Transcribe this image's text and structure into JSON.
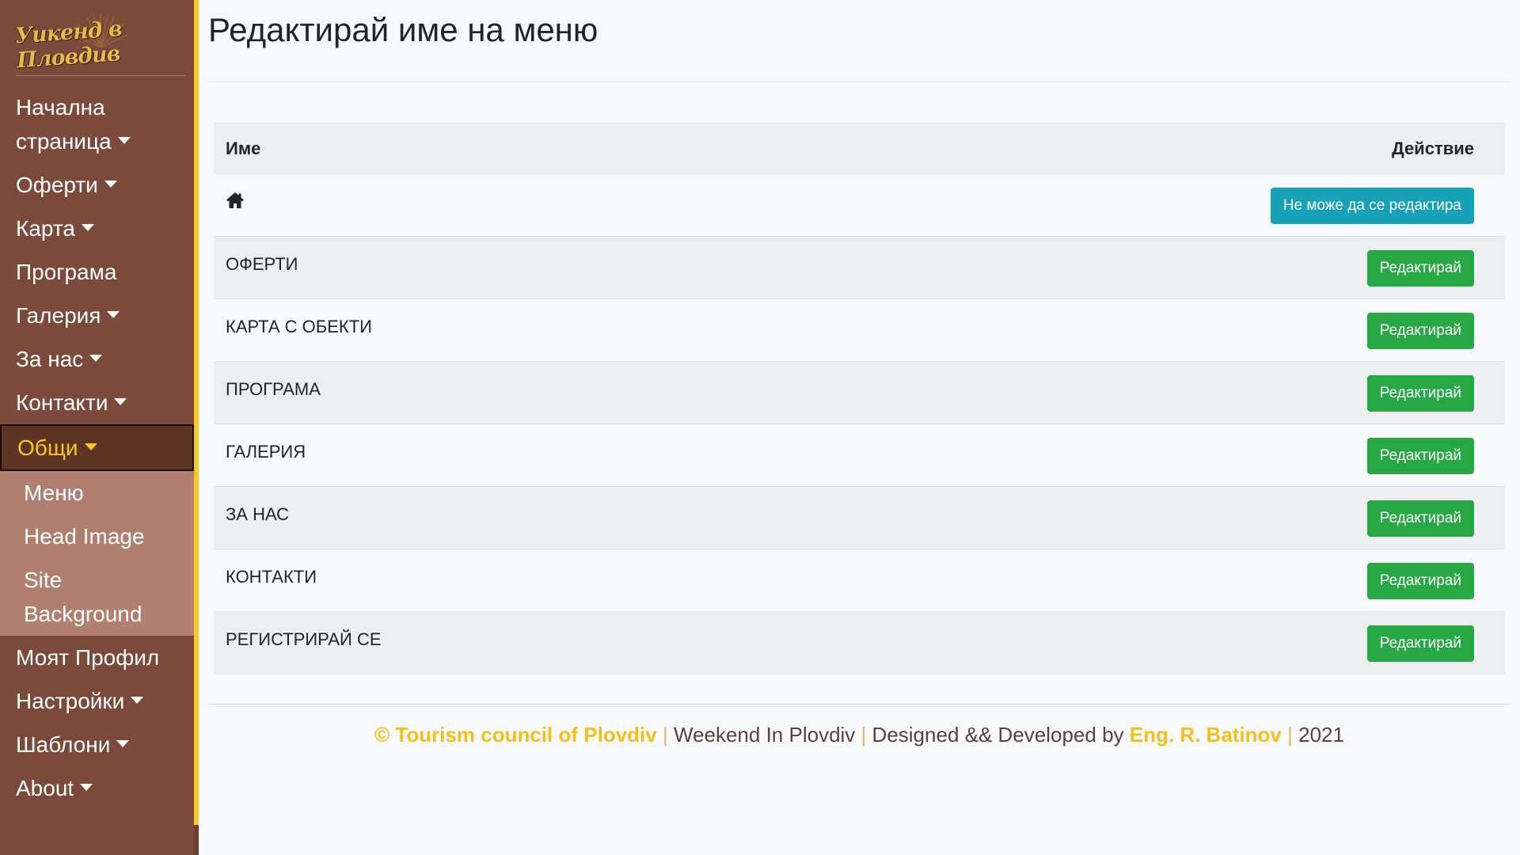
{
  "brand": {
    "logo_text": "Уикенд в Пловдив",
    "colors": {
      "sidebar": "#7b4a3a",
      "accent": "#f7c923",
      "submenu": "#b17f6f",
      "success": "#28a745",
      "info": "#17a2b8"
    }
  },
  "sidebar": {
    "items": [
      {
        "label": "Начална страница",
        "caret": true
      },
      {
        "label": "Оферти",
        "caret": true
      },
      {
        "label": "Карта",
        "caret": true
      },
      {
        "label": "Програма",
        "caret": false
      },
      {
        "label": "Галерия",
        "caret": true
      },
      {
        "label": "За нас",
        "caret": true
      },
      {
        "label": "Контакти",
        "caret": true
      },
      {
        "label": "Общи",
        "caret": true,
        "active": true
      },
      {
        "label": "Моят Профил",
        "caret": false
      },
      {
        "label": "Настройки",
        "caret": true
      },
      {
        "label": "Шаблони",
        "caret": true
      },
      {
        "label": "About",
        "caret": true
      }
    ],
    "submenu": [
      {
        "label": "Меню"
      },
      {
        "label": "Head Image"
      },
      {
        "label": "Site Background"
      }
    ]
  },
  "main": {
    "title": "Редактирай име на меню",
    "table": {
      "headers": {
        "name": "Име",
        "action": "Действие"
      },
      "rows": [
        {
          "name": "",
          "icon": "home-icon",
          "button": "Не може да се редактира",
          "button_type": "info"
        },
        {
          "name": "ОФЕРТИ",
          "button": "Редактирай",
          "button_type": "success"
        },
        {
          "name": "КАРТА С ОБЕКТИ",
          "button": "Редактирай",
          "button_type": "success"
        },
        {
          "name": "ПРОГРАМА",
          "button": "Редактирай",
          "button_type": "success"
        },
        {
          "name": "ГАЛЕРИЯ",
          "button": "Редактирай",
          "button_type": "success"
        },
        {
          "name": "ЗА НАС",
          "button": "Редактирай",
          "button_type": "success"
        },
        {
          "name": "КОНТАКТИ",
          "button": "Редактирай",
          "button_type": "success"
        },
        {
          "name": "РЕГИСТРИРАЙ СЕ",
          "button": "Редактирай",
          "button_type": "success"
        }
      ]
    }
  },
  "footer": {
    "copyright": "© Tourism council of Plovdiv",
    "sep1": "|",
    "site": "Weekend In Plovdiv",
    "sep2": "|",
    "designed": "Designed && Developed by",
    "author": "Eng. R. Batinov",
    "sep3": "|",
    "year": "2021"
  }
}
